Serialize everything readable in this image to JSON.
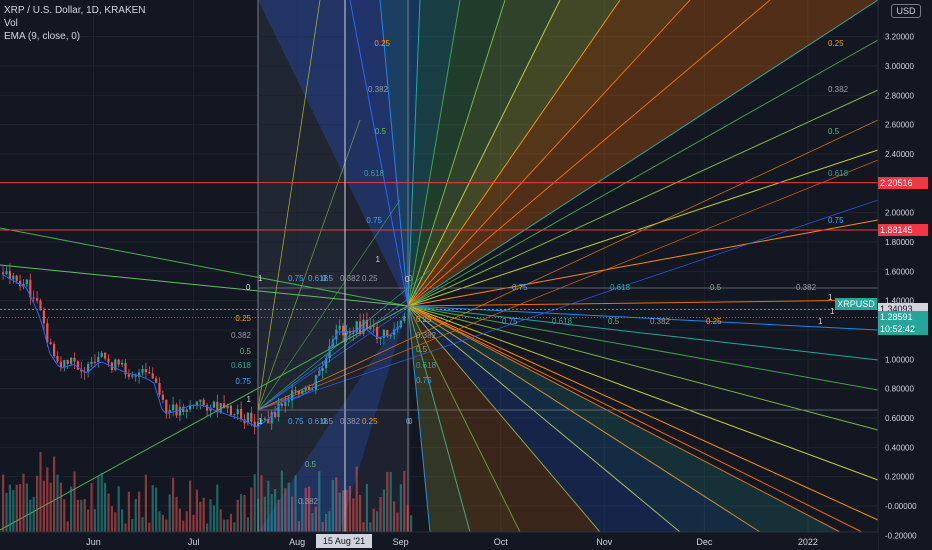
{
  "legend": {
    "symbol": "XRP / U.S. Dollar, 1D, KRAKEN",
    "vol": "Vol",
    "ema": "EMA (9, close, 0)"
  },
  "currency_label": "USD",
  "price_tags": [
    {
      "label": "2.20516",
      "color": "#f23645",
      "price": 2.20516
    },
    {
      "label": "1.88145",
      "color": "#f23645",
      "price": 1.88145
    },
    {
      "label": "1.34093",
      "color": "#d1d4dc",
      "price": 1.34093
    },
    {
      "label": "1.28591",
      "color": "#26a69a",
      "price": 1.28591
    },
    {
      "label": "10:52:42",
      "color": "#26a69a",
      "price": 1.205
    }
  ],
  "symbol_tag": "XRPUSD",
  "crosshair_date": "15 Aug '21",
  "chart_data": {
    "type": "candlestick",
    "title": "XRP / U.S. Dollar, 1D, KRAKEN",
    "y_axis": {
      "ticks": [
        3.2,
        3.0,
        2.8,
        2.6,
        2.4,
        2.2,
        2.0,
        1.8,
        1.6,
        1.4,
        1.2,
        1.0,
        0.8,
        0.6,
        0.4,
        0.2,
        0.0,
        -0.2
      ],
      "tick_labels": [
        "3.20000",
        "3.00000",
        "2.80000",
        "2.60000",
        "2.40000",
        "2.20000",
        "2.00000",
        "1.80000",
        "1.60000",
        "1.40000",
        "1.20000",
        "1.00000",
        "0.80000",
        "0.60000",
        "0.40000",
        "0.20000",
        "-0.00000",
        "-0.20000"
      ],
      "range": [
        -0.3,
        3.45
      ]
    },
    "x_axis": {
      "labels": [
        "Jun",
        "Jul",
        "Aug",
        "Sep",
        "Oct",
        "Nov",
        "Dec",
        "2022"
      ],
      "dates": [
        "2021-06-01",
        "2021-07-01",
        "2021-08-01",
        "2021-09-01",
        "2021-10-01",
        "2021-11-01",
        "2021-12-01",
        "2022-01-01"
      ],
      "range": [
        "2021-05-04",
        "2022-01-22"
      ]
    },
    "horizontal_lines": [
      2.20516,
      1.88145
    ],
    "gann_fan_ratios_up": [
      "0.25",
      "0.382",
      "0.5",
      "0.618",
      "0.75",
      "1"
    ],
    "gann_fan_ratios_upper_right": [
      "0.25",
      "0.382",
      "0.5",
      "0.618",
      "0.75",
      "1"
    ],
    "fib_row_top": [
      "1",
      "0.75",
      "0.618",
      "0.5",
      "0.382",
      "0.25",
      "0"
    ],
    "fib_row_bottom": [
      "1",
      "0.75",
      "0.618",
      "0.5",
      "0.382",
      "0.25",
      "0"
    ],
    "fib_left_column": [
      "0.25",
      "0.382",
      "0.5",
      "0.618",
      "0.75",
      "1"
    ],
    "fib_pivot_column": [
      "0.25",
      "0.382",
      "0.5",
      "0.618",
      "0.75"
    ],
    "fib_right_row": [
      "0.75",
      "0.618",
      "0.5",
      "0.382",
      "1"
    ],
    "fib_right_row2": [
      "0.75",
      "0.618",
      "0.5",
      "0.382",
      "0.25",
      "1"
    ],
    "fib_lower_left": [
      "0.5",
      "0.382"
    ],
    "fan_ratios_left_col": [
      "0.25",
      "0.382",
      "0.5",
      "0.618",
      "0.75"
    ],
    "fan_level_zero_left": "0",
    "fan_level_zero_top": "0",
    "fan_level_zero_bottom": "0",
    "price_path": [
      [
        "2021-05-04",
        1.6
      ],
      [
        "2021-05-08",
        1.55
      ],
      [
        "2021-05-12",
        1.5
      ],
      [
        "2021-05-16",
        1.3
      ],
      [
        "2021-05-19",
        1.05
      ],
      [
        "2021-05-22",
        0.95
      ],
      [
        "2021-05-26",
        0.98
      ],
      [
        "2021-05-30",
        0.92
      ],
      [
        "2021-06-03",
        1.0
      ],
      [
        "2021-06-07",
        0.96
      ],
      [
        "2021-06-11",
        0.92
      ],
      [
        "2021-06-15",
        0.9
      ],
      [
        "2021-06-19",
        0.86
      ],
      [
        "2021-06-22",
        0.64
      ],
      [
        "2021-06-26",
        0.66
      ],
      [
        "2021-06-30",
        0.7
      ],
      [
        "2021-07-04",
        0.7
      ],
      [
        "2021-07-08",
        0.66
      ],
      [
        "2021-07-12",
        0.63
      ],
      [
        "2021-07-16",
        0.6
      ],
      [
        "2021-07-20",
        0.55
      ],
      [
        "2021-07-24",
        0.62
      ],
      [
        "2021-07-28",
        0.74
      ],
      [
        "2021-08-01",
        0.75
      ],
      [
        "2021-08-05",
        0.8
      ],
      [
        "2021-08-09",
        0.98
      ],
      [
        "2021-08-13",
        1.2
      ],
      [
        "2021-08-17",
        1.2
      ],
      [
        "2021-08-21",
        1.23
      ],
      [
        "2021-08-25",
        1.16
      ],
      [
        "2021-08-29",
        1.18
      ],
      [
        "2021-09-02",
        1.27
      ]
    ]
  }
}
